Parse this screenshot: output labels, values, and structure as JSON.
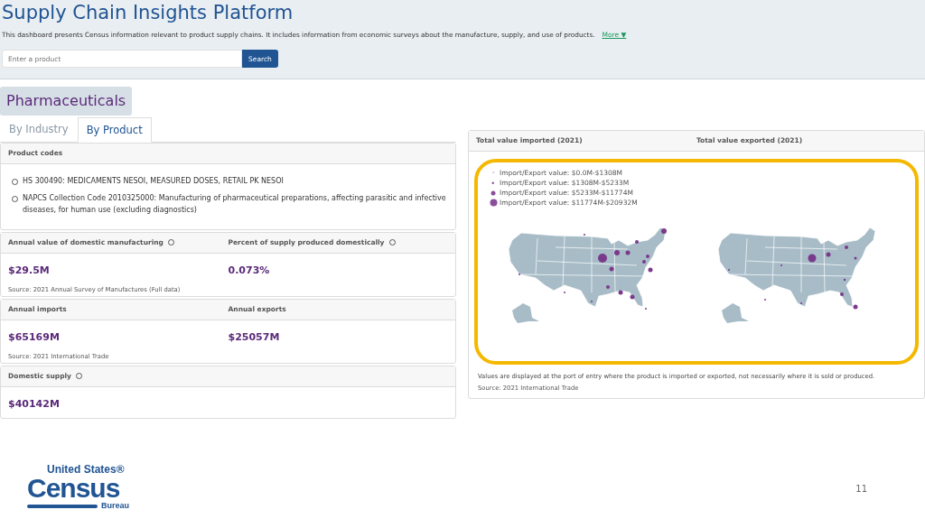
{
  "header": {
    "title": "Supply Chain Insights Platform",
    "description": "This dashboard presents Census information relevant to product supply chains. It includes information from economic surveys about the manufacture, supply, and use of products.",
    "more_link": "More ▼",
    "search": {
      "placeholder": "Enter a product",
      "button": "Search"
    }
  },
  "product_title": "Pharmaceuticals",
  "tabs": [
    {
      "label": "By Industry",
      "selected": false
    },
    {
      "label": "By Product",
      "selected": true
    }
  ],
  "product_codes": {
    "title": "Product codes",
    "items": [
      "HS 300490: MEDICAMENTS NESOI, MEASURED DOSES, RETAIL PK NESOI",
      "NAPCS Collection Code 2010325000: Manufacturing of pharmaceutical preparations, affecting parasitic and infective diseases, for human use (excluding diagnostics)"
    ]
  },
  "stat_cards": [
    {
      "metrics": [
        {
          "label": "Annual value of domestic manufacturing",
          "info": true,
          "value": "$29.5M"
        },
        {
          "label": "Percent of supply produced domestically",
          "info": true,
          "value": "0.073%"
        }
      ],
      "source": {
        "label": "Source:",
        "links": [
          "2021 Annual Survey of Manufactures",
          "(Full data)"
        ]
      }
    },
    {
      "metrics": [
        {
          "label": "Annual imports",
          "info": false,
          "value": "$65169M"
        },
        {
          "label": "Annual exports",
          "info": false,
          "value": "$25057M"
        }
      ],
      "source": {
        "label": "Source:",
        "links": [
          "2021 International Trade"
        ]
      }
    },
    {
      "metrics": [
        {
          "label": "Domestic supply",
          "info": true,
          "value": "$40142M"
        }
      ]
    }
  ],
  "maps_card": {
    "titles": [
      "Total value imported (2021)",
      "Total value exported (2021)"
    ],
    "legend": [
      {
        "label": "Import/Export value: $0.0M-$1308M",
        "kind": "xs"
      },
      {
        "label": "Import/Export value: $1308M-$5233M",
        "kind": "s"
      },
      {
        "label": "Import/Export value: $5233M-$11774M",
        "kind": "m"
      },
      {
        "label": "Import/Export value: $11774M-$20932M",
        "kind": "l"
      }
    ],
    "note": "Values are displayed at the port of entry where the product is imported or exported, not necessarily where it is sold or produced.",
    "source": {
      "label": "Source:",
      "links": [
        "2021 International Trade"
      ]
    }
  },
  "logo": {
    "line1": "United States®",
    "line2": "Census",
    "line3": "Bureau"
  },
  "page_number": "11"
}
